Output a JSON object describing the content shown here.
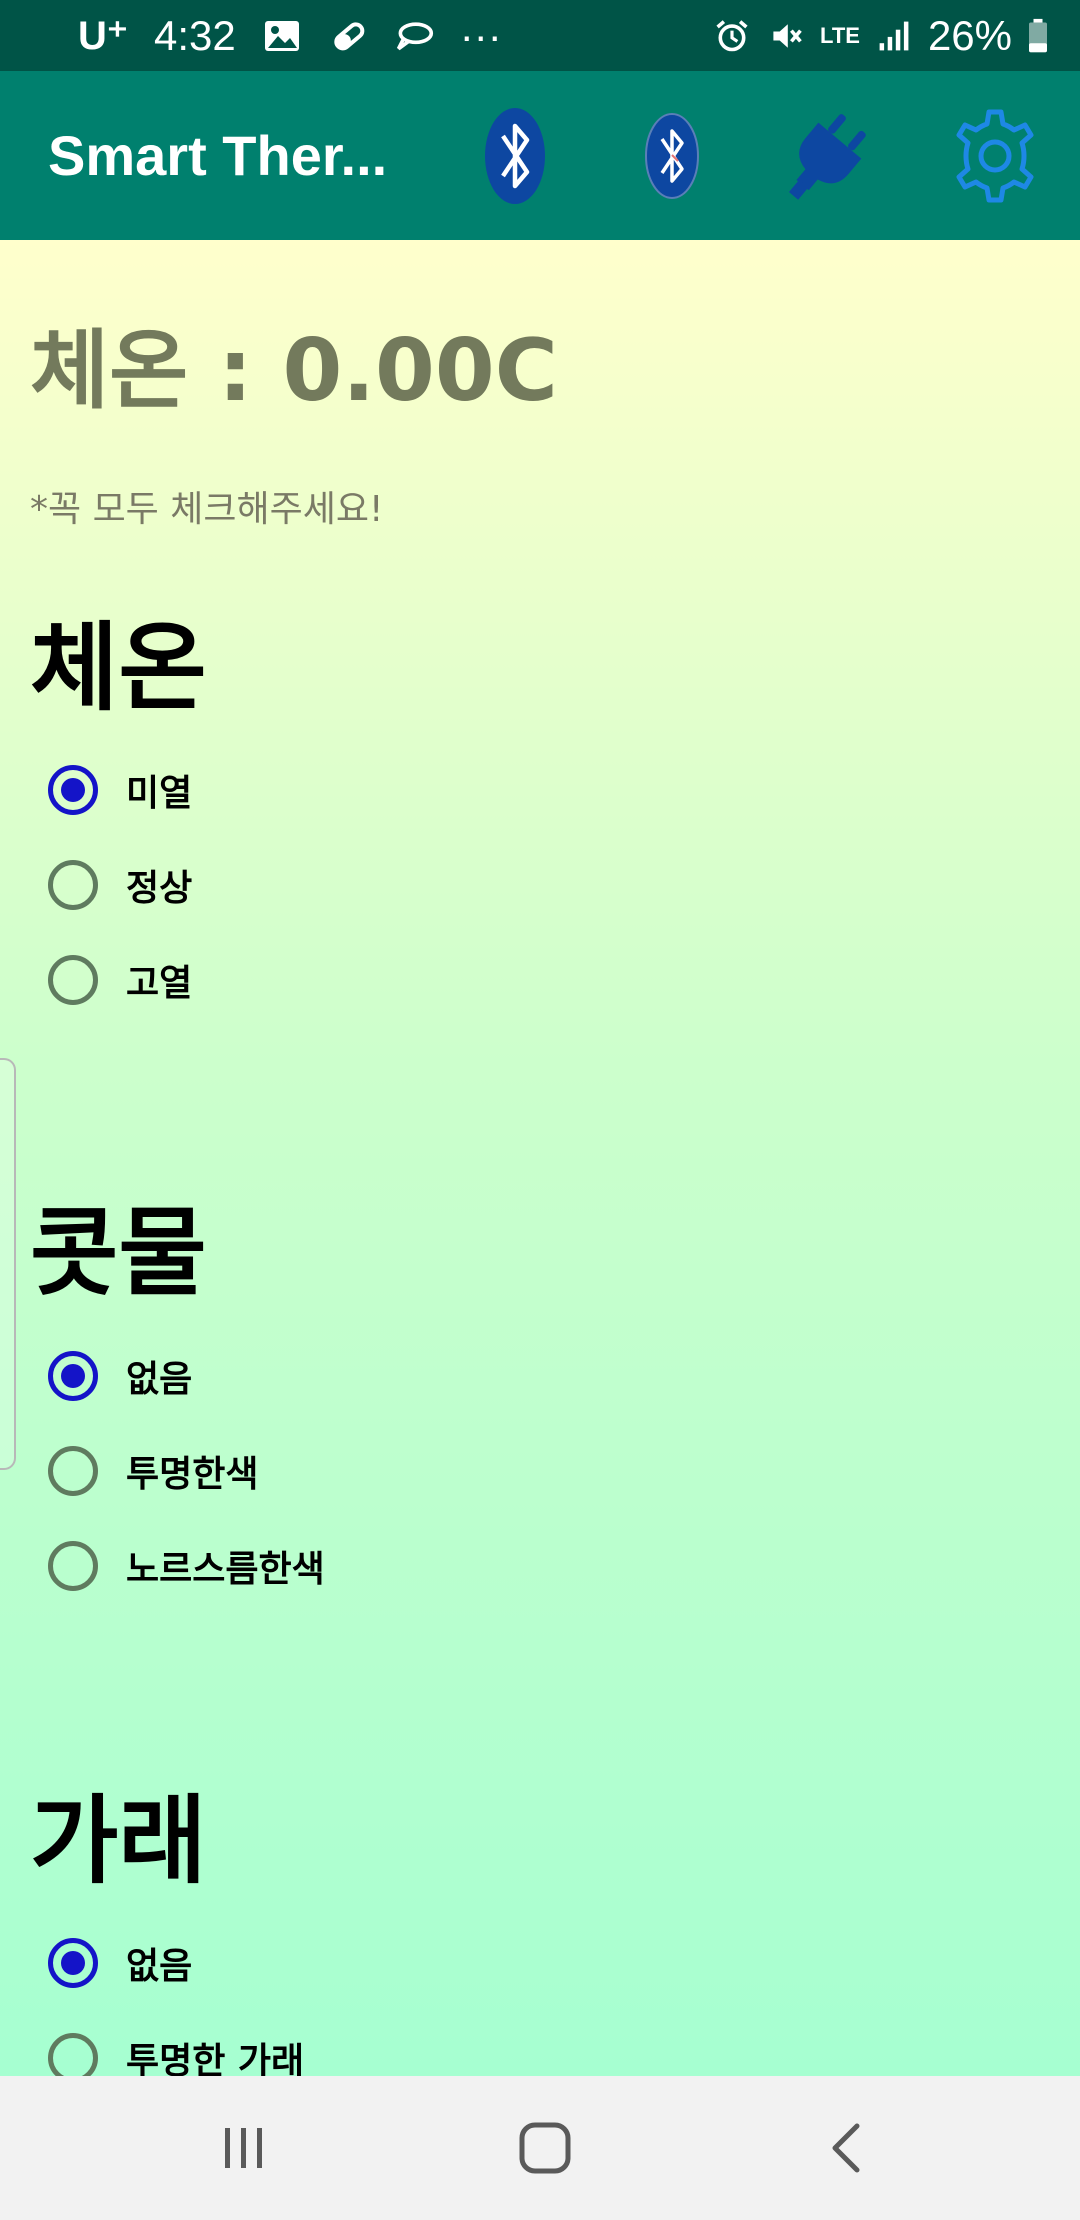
{
  "status_bar": {
    "carrier": "U⁺",
    "time": "4:32",
    "more": "···",
    "network": "LTE",
    "battery": "26%"
  },
  "app_bar": {
    "title": "Smart Ther...",
    "icons": [
      "bluetooth-icon",
      "bluetooth-disconnected-icon",
      "power-plug-icon",
      "gear-icon"
    ],
    "accent": "#00806e",
    "plug_color": "#0d47a1",
    "gear_color": "#1e88e5"
  },
  "main": {
    "temperature_label": "체온 : 0.00C",
    "notice": "*꼭 모두 체크해주세요!",
    "sections": [
      {
        "title": "체온",
        "options": [
          {
            "label": "미열",
            "checked": true
          },
          {
            "label": "정상",
            "checked": false
          },
          {
            "label": "고열",
            "checked": false
          }
        ]
      },
      {
        "title": "콧물",
        "options": [
          {
            "label": "없음",
            "checked": true
          },
          {
            "label": "투명한색",
            "checked": false
          },
          {
            "label": "노르스름한색",
            "checked": false
          }
        ]
      },
      {
        "title": "가래",
        "options": [
          {
            "label": "없음",
            "checked": true
          },
          {
            "label": "투명한 가래",
            "checked": false
          }
        ]
      }
    ],
    "radio_checked_color": "#1414c8",
    "radio_unchecked_color": "#5f7b5f"
  },
  "nav_bar": {
    "icons": [
      "recent-apps-icon",
      "home-icon",
      "back-icon"
    ]
  }
}
